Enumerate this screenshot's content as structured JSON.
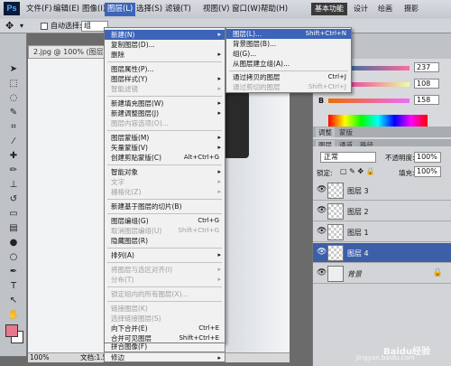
{
  "app": {
    "logo": "Ps"
  },
  "menubar": {
    "items": [
      "文件(F)",
      "编辑(E)",
      "图像(I)",
      "图层(L)",
      "选择(S)",
      "滤镜(T)",
      "视图(V)",
      "窗口(W)",
      "帮助(H)"
    ],
    "workspaces": [
      "基本功能",
      "设计",
      "绘画",
      "摄影"
    ]
  },
  "options": {
    "auto_select_label": "自动选择:",
    "auto_select_value": "组"
  },
  "document": {
    "tab_title": "2.jpg @ 100% (图层 4, ...",
    "zoom": "100%",
    "doc_size": "文档:1.59M/1.59M"
  },
  "layer_menu": {
    "items": [
      {
        "label": "新建(N)",
        "arrow": "▸"
      },
      {
        "label": "复制图层(D)..."
      },
      {
        "label": "删除",
        "arrow": "▸"
      },
      {
        "label": "图层属性(P)..."
      },
      {
        "label": "图层样式(Y)",
        "arrow": "▸"
      },
      {
        "label": "智能滤镜",
        "arrow": "▸"
      },
      {
        "label": "新建填充图层(W)",
        "arrow": "▸"
      },
      {
        "label": "新建调整图层(J)",
        "arrow": "▸"
      },
      {
        "label": "图层内容选项(O)..."
      },
      {
        "label": "图层蒙版(M)",
        "arrow": "▸"
      },
      {
        "label": "矢量蒙版(V)",
        "arrow": "▸"
      },
      {
        "label": "创建剪贴蒙版(C)",
        "shortcut": "Alt+Ctrl+G"
      },
      {
        "label": "智能对象",
        "arrow": "▸"
      },
      {
        "label": "文字",
        "arrow": "▸"
      },
      {
        "label": "栅格化(Z)",
        "arrow": "▸"
      },
      {
        "label": "新建基于图层的切片(B)"
      },
      {
        "label": "图层编组(G)",
        "shortcut": "Ctrl+G"
      },
      {
        "label": "取消图层编组(U)",
        "shortcut": "Shift+Ctrl+G"
      },
      {
        "label": "隐藏图层(R)"
      },
      {
        "label": "排列(A)",
        "arrow": "▸"
      },
      {
        "label": "将图层与选区对齐(I)",
        "arrow": "▸"
      },
      {
        "label": "分布(T)",
        "arrow": "▸"
      },
      {
        "label": "锁定组内的所有图层(X)..."
      },
      {
        "label": "链接图层(K)"
      },
      {
        "label": "选择链接图层(S)"
      },
      {
        "label": "向下合并(E)",
        "shortcut": "Ctrl+E"
      },
      {
        "label": "合并可见图层",
        "shortcut": "Shift+Ctrl+E"
      },
      {
        "label": "拼合图像(F)"
      },
      {
        "label": "修边",
        "arrow": "▸"
      }
    ]
  },
  "new_submenu": {
    "items": [
      {
        "label": "图层(L)...",
        "shortcut": "Shift+Ctrl+N"
      },
      {
        "label": "背景图层(B)..."
      },
      {
        "label": "组(G)..."
      },
      {
        "label": "从图层建立组(A)..."
      },
      {
        "label": "通过拷贝的图层",
        "shortcut": "Ctrl+J"
      },
      {
        "label": "通过剪切的图层",
        "shortcut": "Shift+Ctrl+J"
      }
    ]
  },
  "color_panel": {
    "r_label": "R",
    "g_label": "G",
    "b_label": "B",
    "r": "237",
    "g": "108",
    "b": "158"
  },
  "panel_tabs": {
    "top": [
      "调整",
      "蒙版"
    ],
    "layers": [
      "图层",
      "通道",
      "路径"
    ]
  },
  "layers_panel": {
    "blend_mode": "正常",
    "opacity_label": "不透明度:",
    "opacity": "100%",
    "lock_label": "锁定:",
    "fill_label": "填充:",
    "fill": "100%",
    "layers": [
      {
        "name": "图层 3"
      },
      {
        "name": "图层 2"
      },
      {
        "name": "图层 1"
      },
      {
        "name": "图层 4"
      },
      {
        "name": "背景"
      }
    ]
  },
  "colors": {
    "accent": "#3c64b8",
    "foreground": "#e8788c",
    "background": "#ffffff"
  },
  "watermark": {
    "main": "Baidu经验",
    "sub": "jingyan.baidu.com"
  }
}
